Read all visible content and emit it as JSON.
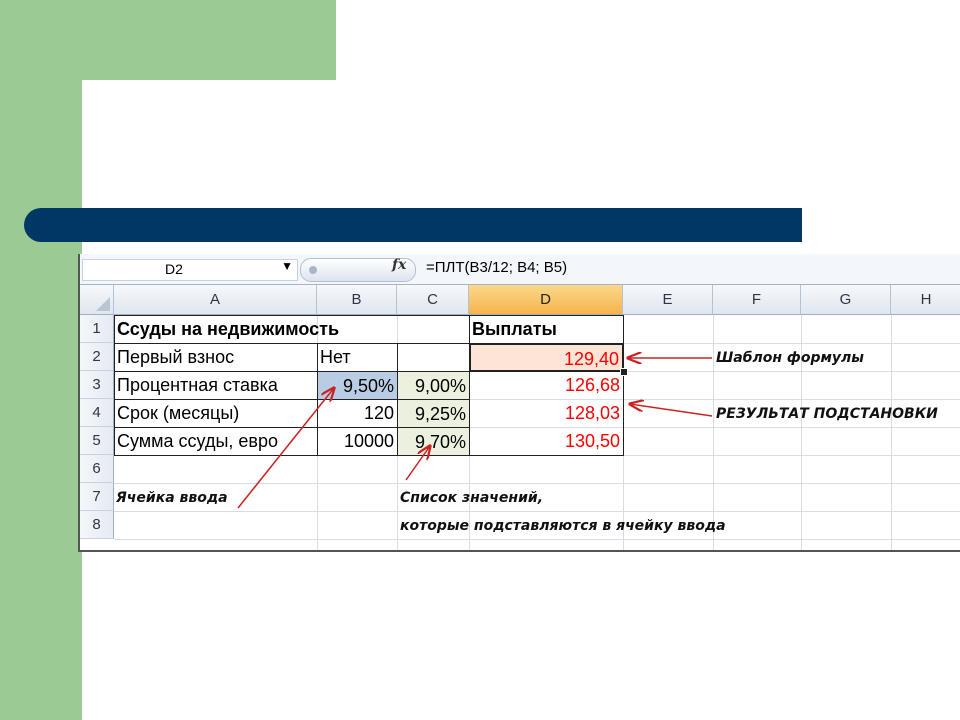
{
  "formula_bar": {
    "name_box": "D2",
    "fx_icon": "fx-icon",
    "formula": "=ПЛТ(B3/12; B4; B5)"
  },
  "columns": [
    "A",
    "B",
    "C",
    "D",
    "E",
    "F",
    "G",
    "H"
  ],
  "selected_column": "D",
  "rows": [
    "1",
    "2",
    "3",
    "4",
    "5",
    "6",
    "7",
    "8"
  ],
  "cells": {
    "A1": "Ссуды на недвижимость",
    "D1": "Выплаты",
    "A2": "Первый взнос",
    "B2": "Нет",
    "D2": "129,40",
    "A3": "Процентная ставка",
    "B3": "9,50%",
    "C3": "9,00%",
    "D3": "126,68",
    "A4": "Срок (месяцы)",
    "B4": "120",
    "C4": "9,25%",
    "D4": "128,03",
    "A5": "Сумма ссуды, евро",
    "B5": "10000",
    "C5": "9,70%",
    "D5": "130,50",
    "A7": "Ячейка ввода"
  },
  "annotations": {
    "template": "Шаблон формулы",
    "result": "РЕЗУЛЬТАТ ПОДСТАНОВКИ",
    "list_line1": "Список значений,",
    "list_line2": "которые подставляются в ячейку ввода"
  },
  "colors": {
    "slide_green": "#9cca94",
    "title_bar": "#003865",
    "result_red": "#ff0000",
    "input_blue": "#b8cce4",
    "values_green": "#ebf1de",
    "formula_cell": "#fce4d6",
    "arrow": "#cc2222"
  }
}
